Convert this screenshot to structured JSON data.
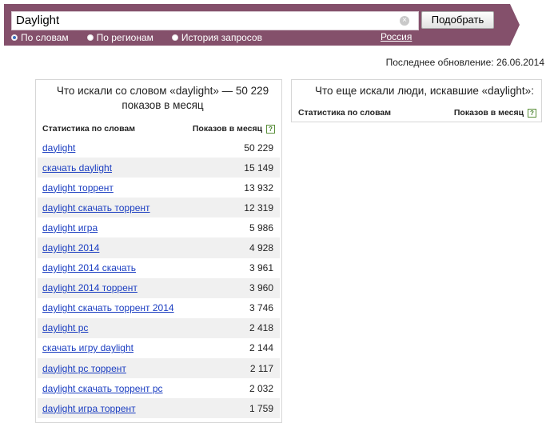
{
  "search": {
    "query": "Daylight",
    "button_label": "Подобрать",
    "clear_icon": "×"
  },
  "modes": [
    {
      "label": "По словам",
      "checked": true
    },
    {
      "label": "По регионам",
      "checked": false
    },
    {
      "label": "История запросов",
      "checked": false
    }
  ],
  "region": "Россия",
  "updated": "Последнее обновление: 26.06.2014",
  "left_panel": {
    "title": "Что искали со словом «daylight» — 50 229 показов в месяц",
    "col_words": "Статистика по словам",
    "col_views": "Показов в месяц",
    "rows": [
      {
        "phrase": "daylight",
        "count": "50 229"
      },
      {
        "phrase": "скачать daylight",
        "count": "15 149"
      },
      {
        "phrase": "daylight торрент",
        "count": "13 932"
      },
      {
        "phrase": "daylight скачать торрент",
        "count": "12 319"
      },
      {
        "phrase": "daylight игра",
        "count": "5 986"
      },
      {
        "phrase": "daylight 2014",
        "count": "4 928"
      },
      {
        "phrase": "daylight 2014 скачать",
        "count": "3 961"
      },
      {
        "phrase": "daylight 2014 торрент",
        "count": "3 960"
      },
      {
        "phrase": "daylight скачать торрент 2014",
        "count": "3 746"
      },
      {
        "phrase": "daylight pc",
        "count": "2 418"
      },
      {
        "phrase": "скачать игру daylight",
        "count": "2 144"
      },
      {
        "phrase": "daylight pc торрент",
        "count": "2 117"
      },
      {
        "phrase": "daylight скачать торрент pc",
        "count": "2 032"
      },
      {
        "phrase": "daylight игра торрент",
        "count": "1 759"
      }
    ]
  },
  "right_panel": {
    "title": "Что еще искали люди, искавшие «daylight»:",
    "col_words": "Статистика по словам",
    "col_views": "Показов в месяц"
  },
  "help_glyph": "?"
}
